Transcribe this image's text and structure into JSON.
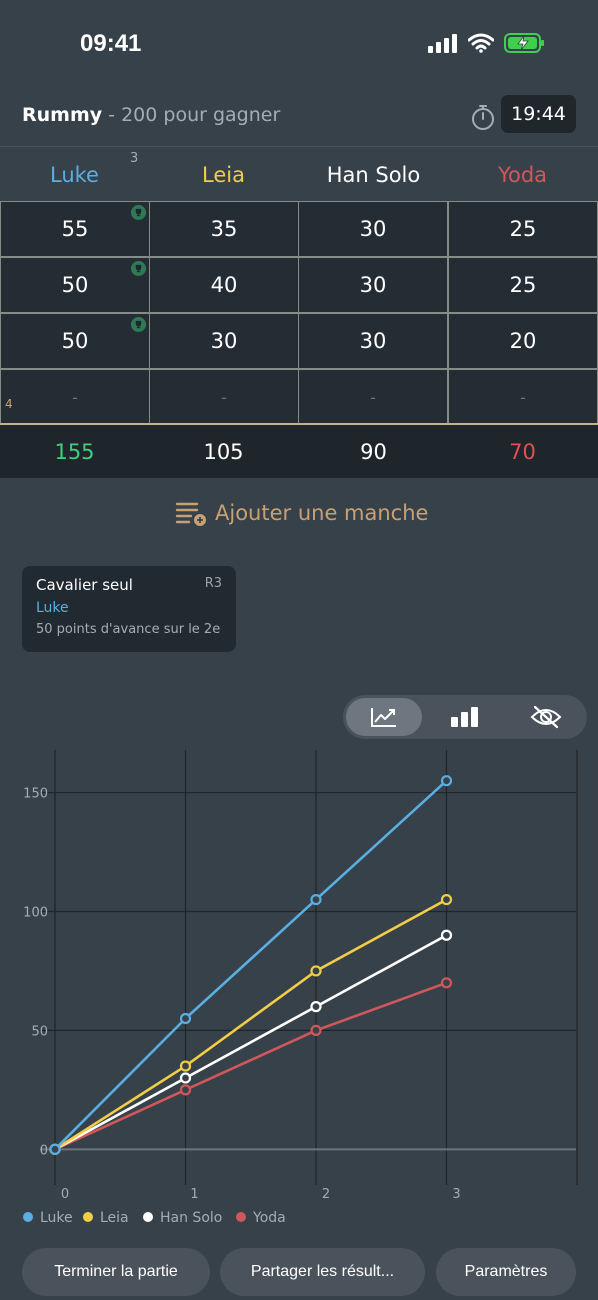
{
  "status_bar": {
    "time": "09:41"
  },
  "header": {
    "game_name": "Rummy",
    "game_subtitle": " - 200 pour gagner",
    "timer": "19:44"
  },
  "players": [
    {
      "name": "Luke",
      "color": "#5aaee2",
      "rounds_badge": "3"
    },
    {
      "name": "Leia",
      "color": "#f2cd45"
    },
    {
      "name": "Han Solo",
      "color": "#ffffff"
    },
    {
      "name": "Yoda",
      "color": "#d0585a"
    }
  ],
  "rounds": [
    {
      "scores": [
        "55",
        "35",
        "30",
        "25"
      ],
      "trophy": true
    },
    {
      "scores": [
        "50",
        "40",
        "30",
        "25"
      ],
      "trophy": true
    },
    {
      "scores": [
        "50",
        "30",
        "30",
        "20"
      ],
      "trophy": true
    },
    {
      "scores": [
        "-",
        "-",
        "-",
        "-"
      ],
      "row_label": "4"
    }
  ],
  "totals": [
    {
      "value": "155",
      "color": "#3fcf7f"
    },
    {
      "value": "105",
      "color": "#ffffff"
    },
    {
      "value": "90",
      "color": "#ffffff"
    },
    {
      "value": "70",
      "color": "#e0524e"
    }
  ],
  "add_round_label": "Ajouter une manche",
  "achievement": {
    "title": "Cavalier seul",
    "round": "R3",
    "player": "Luke",
    "description": "50 points d'avance sur le 2e"
  },
  "chart_toggle": {
    "active": "line",
    "options": [
      "line-chart-icon",
      "bar-chart-icon",
      "hide-icon"
    ]
  },
  "chart_data": {
    "type": "line",
    "x": [
      0,
      1,
      2,
      3
    ],
    "xlim": [
      0,
      4
    ],
    "ylim": [
      -15,
      170
    ],
    "yticks": [
      0,
      50,
      100,
      150
    ],
    "grid": true,
    "legend_position": "bottom-left",
    "series": [
      {
        "name": "Luke",
        "color": "#5aaee2",
        "values": [
          0,
          55,
          105,
          155
        ]
      },
      {
        "name": "Leia",
        "color": "#f2cd45",
        "values": [
          0,
          35,
          75,
          105
        ]
      },
      {
        "name": "Han Solo",
        "color": "#ffffff",
        "values": [
          0,
          30,
          60,
          90
        ]
      },
      {
        "name": "Yoda",
        "color": "#d0585a",
        "values": [
          0,
          25,
          50,
          70
        ]
      }
    ]
  },
  "footer": {
    "end_game": "Terminer la partie",
    "share_results": "Partager les résult...",
    "settings": "Paramètres"
  }
}
